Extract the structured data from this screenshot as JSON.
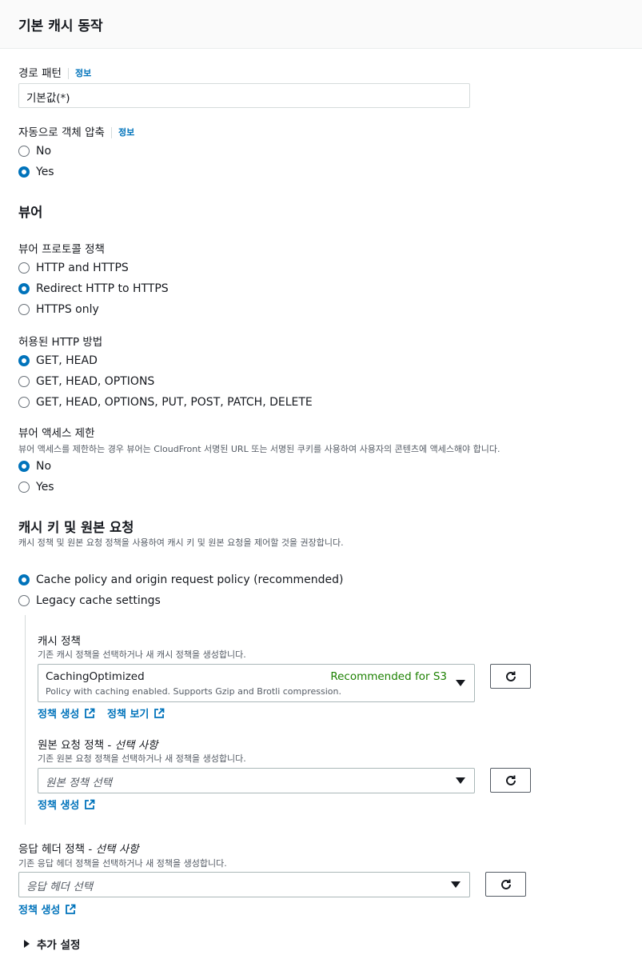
{
  "header": {
    "title": "기본 캐시 동작"
  },
  "path_pattern": {
    "label": "경로 패턴",
    "info": "정보",
    "value": "기본값(*)"
  },
  "compress": {
    "label": "자동으로 객체 압축",
    "info": "정보",
    "options": [
      "No",
      "Yes"
    ],
    "selected": "Yes"
  },
  "viewer": {
    "title": "뷰어",
    "protocol": {
      "label": "뷰어 프로토콜 정책",
      "options": [
        "HTTP and HTTPS",
        "Redirect HTTP to HTTPS",
        "HTTPS only"
      ],
      "selected": "Redirect HTTP to HTTPS"
    },
    "methods": {
      "label": "허용된 HTTP 방법",
      "options": [
        "GET, HEAD",
        "GET, HEAD, OPTIONS",
        "GET, HEAD, OPTIONS, PUT, POST, PATCH, DELETE"
      ],
      "selected": "GET, HEAD"
    },
    "restrict": {
      "label": "뷰어 액세스 제한",
      "description": "뷰어 액세스를 제한하는 경우 뷰어는 CloudFront 서명된 URL 또는 서명된 쿠키를 사용하여 사용자의 콘텐츠에 액세스해야 합니다.",
      "options": [
        "No",
        "Yes"
      ],
      "selected": "No"
    }
  },
  "cache_key": {
    "title": "캐시 키 및 원본 요청",
    "description": "캐시 정책 및 원본 요청 정책을 사용하여 캐시 키 및 원본 요청을 제어할 것을 권장합니다.",
    "options": [
      "Cache policy and origin request policy (recommended)",
      "Legacy cache settings"
    ],
    "selected": "Cache policy and origin request policy (recommended)",
    "cache_policy": {
      "label": "캐시 정책",
      "description": "기존 캐시 정책을 선택하거나 새 캐시 정책을 생성합니다.",
      "value": "CachingOptimized",
      "value_sub": "Policy with caching enabled. Supports Gzip and Brotli compression.",
      "tag": "Recommended for S3",
      "create_link": "정책 생성",
      "view_link": "정책 보기"
    },
    "origin_policy": {
      "label_main": "원본 요청 정책 - ",
      "label_opt": "선택 사항",
      "description": "기존 원본 요청 정책을 선택하거나 새 정책을 생성합니다.",
      "placeholder": "원본 정책 선택",
      "create_link": "정책 생성"
    }
  },
  "response_headers": {
    "label_main": "응답 헤더 정책 - ",
    "label_opt": "선택 사항",
    "description": "기존 응답 헤더 정책을 선택하거나 새 정책을 생성합니다.",
    "placeholder": "응답 헤더 선택",
    "create_link": "정책 생성"
  },
  "additional": {
    "label": "추가 설정"
  },
  "colors": {
    "accent": "#0073bb",
    "recommended": "#1d8102",
    "border": "#d5dbdb"
  },
  "icons": [
    "refresh-icon",
    "external-link-icon",
    "caret-down-icon",
    "expand-triangle-icon"
  ]
}
